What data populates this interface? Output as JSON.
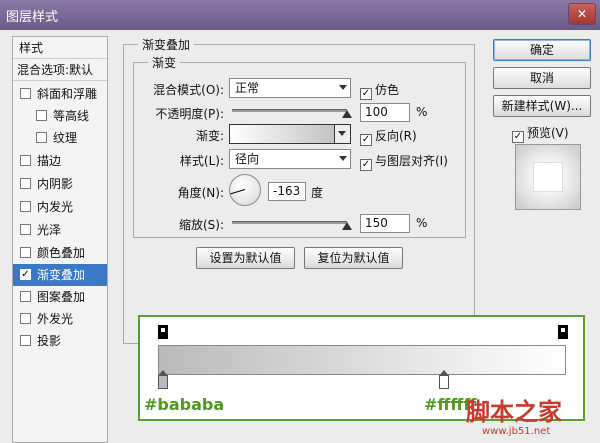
{
  "window": {
    "title": "图层样式",
    "close_icon": "close-icon"
  },
  "styles_panel": {
    "header": "样式",
    "blend_options": "混合选项:默认",
    "items": [
      {
        "label": "斜面和浮雕",
        "checked": false,
        "indent": false
      },
      {
        "label": "等高线",
        "checked": false,
        "indent": true
      },
      {
        "label": "纹理",
        "checked": false,
        "indent": true
      },
      {
        "label": "描边",
        "checked": false,
        "indent": false
      },
      {
        "label": "内阴影",
        "checked": false,
        "indent": false
      },
      {
        "label": "内发光",
        "checked": false,
        "indent": false
      },
      {
        "label": "光泽",
        "checked": false,
        "indent": false
      },
      {
        "label": "颜色叠加",
        "checked": false,
        "indent": false
      },
      {
        "label": "渐变叠加",
        "checked": true,
        "indent": false,
        "active": true
      },
      {
        "label": "图案叠加",
        "checked": false,
        "indent": false
      },
      {
        "label": "外发光",
        "checked": false,
        "indent": false
      },
      {
        "label": "投影",
        "checked": false,
        "indent": false
      }
    ]
  },
  "gradient_overlay": {
    "group_title": "渐变叠加",
    "subgroup_title": "渐变",
    "blend_mode": {
      "label": "混合模式(O):",
      "value": "正常"
    },
    "dither": {
      "label": "仿色",
      "checked": true
    },
    "opacity": {
      "label": "不透明度(P):",
      "value": "100",
      "unit": "%",
      "fraction": 1.0
    },
    "gradient": {
      "label": "渐变:",
      "from_color": "#ffffff",
      "to_color": "#bababa"
    },
    "reverse": {
      "label": "反向(R)",
      "checked": true
    },
    "style": {
      "label": "样式(L):",
      "value": "径向"
    },
    "align": {
      "label": "与图层对齐(I)",
      "checked": true
    },
    "angle": {
      "label": "角度(N):",
      "value": "-163",
      "unit": "度",
      "degrees": -163
    },
    "scale": {
      "label": "缩放(S):",
      "value": "150",
      "unit": "%",
      "fraction": 1.0
    },
    "set_default": "设置为默认值",
    "reset_default": "复位为默认值"
  },
  "buttons": {
    "ok": "确定",
    "cancel": "取消",
    "new_style": "新建样式(W)...",
    "preview": {
      "label": "预览(V)",
      "checked": true
    }
  },
  "gradient_editor": {
    "left_color": "#bababa",
    "right_color": "#ffffff",
    "left_label": "#bababa",
    "right_label": "#ffffff",
    "right_stop_location_fraction": 0.7
  },
  "watermark": {
    "text": "脚本之家",
    "url": "www.jb51.net"
  }
}
